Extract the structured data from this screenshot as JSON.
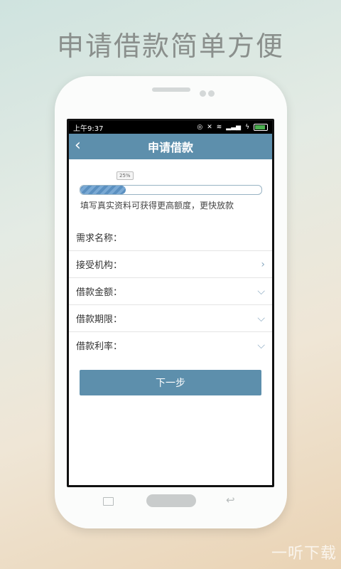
{
  "headline": "申请借款简单方便",
  "status_bar": {
    "time": "上午9:37"
  },
  "app": {
    "title": "申请借款"
  },
  "progress": {
    "label": "25%",
    "value": 0.25
  },
  "hint": "填写真实资料可获得更高额度，更快放款",
  "form": {
    "rows": [
      {
        "label": "需求名称：",
        "control": "text"
      },
      {
        "label": "接受机构：",
        "control": "chevron-right"
      },
      {
        "label": "借款金额：",
        "control": "chevron-down"
      },
      {
        "label": "借款期限：",
        "control": "chevron-down"
      },
      {
        "label": "借款利率：",
        "control": "chevron-down"
      }
    ]
  },
  "next_button": {
    "label": "下一步"
  },
  "watermark": "一听下载",
  "colors": {
    "accent": "#5d8fac",
    "progress": "#5b90c0"
  }
}
